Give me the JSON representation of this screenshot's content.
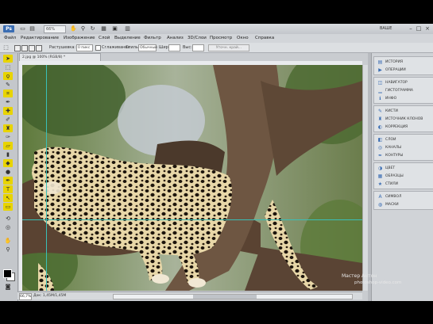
{
  "app": {
    "logo": "Ps",
    "zoom": "66%",
    "workspace": "ВАШЕ"
  },
  "titlebar_icons": [
    "document-icon",
    "layout-icon",
    "hand-icon",
    "zoom-icon",
    "rotate-icon",
    "grid-icon",
    "screen-mode-icon",
    "arrange-icon"
  ],
  "menu": [
    "Файл",
    "Редактирование",
    "Изображение",
    "Слой",
    "Выделение",
    "Фильтр",
    "Анализ",
    "3D/Слои",
    "Просмотр",
    "Окно",
    "Справка"
  ],
  "options": {
    "feather_label": "Растушевка:",
    "feather_value": "0 пикс",
    "antialias_label": "Сглаживание",
    "style_label": "Стиль:",
    "style_value": "Обычный",
    "width_label": "Шир:",
    "height_label": "Выс:",
    "refine_button": "Уточн. край..."
  },
  "document": {
    "tab": "2.jpg @ 100% (RGB/8) *",
    "zoom": "66,7%",
    "status": "Док: 1,45M/1,45M"
  },
  "panel": {
    "groups": [
      {
        "items": [
          {
            "icon": "history-icon",
            "label": "ИСТОРИЯ"
          },
          {
            "icon": "actions-icon",
            "label": "ОПЕРАЦИИ"
          }
        ]
      },
      {
        "items": [
          {
            "icon": "navigator-icon",
            "label": "НАВИГАТОР"
          },
          {
            "icon": "histogram-icon",
            "label": "ГИСТОГРАММА"
          },
          {
            "icon": "info-icon",
            "label": "ИНФО"
          }
        ]
      },
      {
        "items": [
          {
            "icon": "brushes-icon",
            "label": "КИСТИ"
          },
          {
            "icon": "clone-source-icon",
            "label": "ИСТОЧНИК КЛОНОВ"
          },
          {
            "icon": "adjustments-icon",
            "label": "КОРРЕКЦИЯ"
          }
        ]
      },
      {
        "items": [
          {
            "icon": "layers-icon",
            "label": "СЛОИ"
          },
          {
            "icon": "channels-icon",
            "label": "КАНАЛЫ"
          },
          {
            "icon": "paths-icon",
            "label": "КОНТУРЫ"
          }
        ]
      },
      {
        "items": [
          {
            "icon": "color-icon",
            "label": "ЦВЕТ"
          },
          {
            "icon": "swatches-icon",
            "label": "ОБРАЗЦЫ"
          },
          {
            "icon": "styles-icon",
            "label": "СТИЛИ"
          }
        ]
      },
      {
        "items": [
          {
            "icon": "character-icon",
            "label": "СИМВОЛ"
          },
          {
            "icon": "masks-icon",
            "label": "МАСКИ"
          }
        ]
      }
    ]
  },
  "watermark": {
    "line1": "Мастер Антон",
    "line2": "photoshop-video.com"
  },
  "colors": {
    "accent": "#3a6db3",
    "tool_highlight": "#e8d400",
    "guide": "#39c0b8"
  }
}
